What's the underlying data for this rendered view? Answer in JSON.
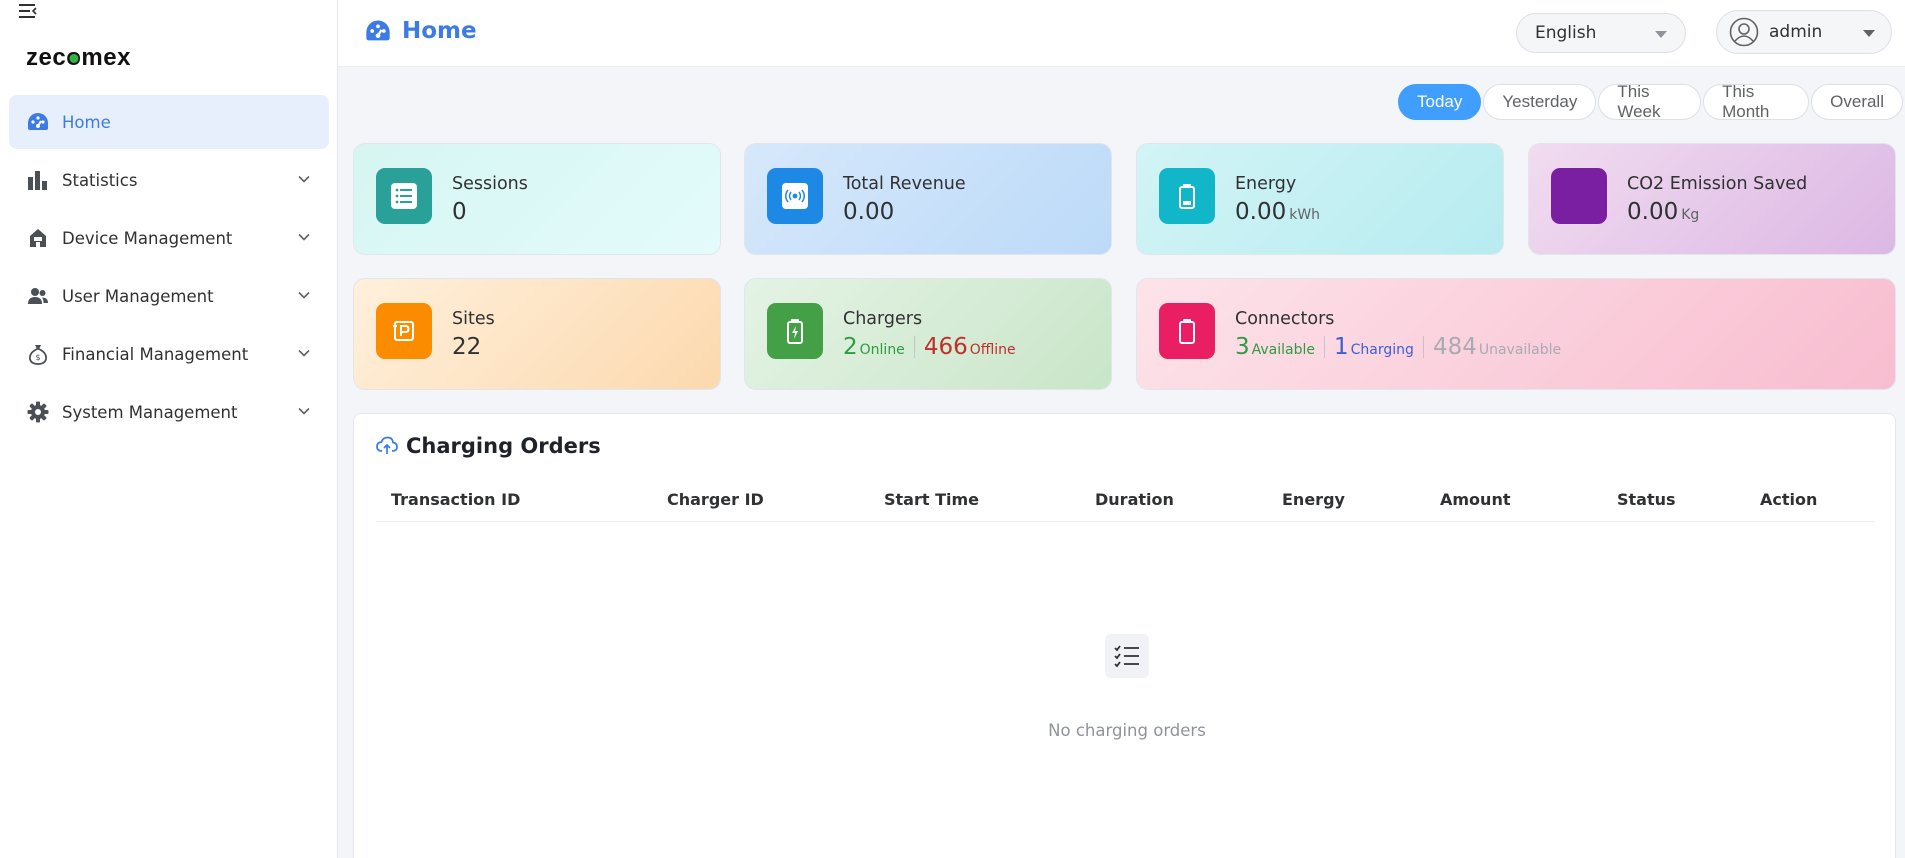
{
  "brand": {
    "logo_text_a": "zec",
    "logo_text_o": "o",
    "logo_text_b": "mex"
  },
  "sidebar": {
    "items": [
      {
        "label": "Home",
        "icon": "dashboard-icon",
        "active": true
      },
      {
        "label": "Statistics",
        "icon": "bar-chart-icon"
      },
      {
        "label": "Device Management",
        "icon": "station-icon"
      },
      {
        "label": "User Management",
        "icon": "users-icon"
      },
      {
        "label": "Financial Management",
        "icon": "money-bag-icon"
      },
      {
        "label": "System Management",
        "icon": "gear-icon"
      }
    ]
  },
  "header": {
    "title": "Home",
    "language": "English",
    "user": "admin"
  },
  "periods": {
    "items": [
      "Today",
      "Yesterday",
      "This Week",
      "This Month",
      "Overall"
    ],
    "selected": "Today"
  },
  "cards": {
    "sessions": {
      "label": "Sessions",
      "value": "0"
    },
    "revenue": {
      "label": "Total Revenue",
      "value": "0.00"
    },
    "energy": {
      "label": "Energy",
      "value": "0.00",
      "unit": "kWh"
    },
    "co2": {
      "label": "CO2 Emission Saved",
      "value": "0.00",
      "unit": "Kg"
    },
    "sites": {
      "label": "Sites",
      "value": "22"
    },
    "chargers": {
      "label": "Chargers",
      "online_value": "2",
      "online_label": "Online",
      "offline_value": "466",
      "offline_label": "Offline"
    },
    "connectors": {
      "label": "Connectors",
      "available_value": "3",
      "available_label": "Available",
      "charging_value": "1",
      "charging_label": "Charging",
      "unavailable_value": "484",
      "unavailable_label": "Unavailable"
    }
  },
  "orders": {
    "title": "Charging Orders",
    "columns": [
      "Transaction ID",
      "Charger ID",
      "Start Time",
      "Duration",
      "Energy",
      "Amount",
      "Status",
      "Action"
    ],
    "rows": [],
    "empty_text": "No charging orders"
  },
  "colors": {
    "accent": "#3c7be3",
    "primary_button": "#409eff",
    "online": "#2e9c3f",
    "offline": "#c0302b",
    "charging": "#3c5fd4",
    "unavailable": "#a8abb2"
  }
}
